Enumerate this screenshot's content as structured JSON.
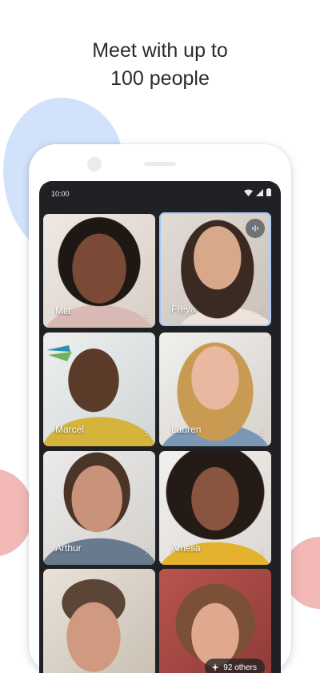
{
  "headline": {
    "line1": "Meet with up to",
    "line2": "100 people"
  },
  "status_bar": {
    "time": "10:00",
    "icons": [
      "wifi-icon",
      "cell-signal-icon",
      "battery-icon"
    ]
  },
  "participants": [
    {
      "name": "Mia",
      "speaking": false
    },
    {
      "name": "Freya",
      "speaking": true
    },
    {
      "name": "Marcel",
      "speaking": false
    },
    {
      "name": "Lauren",
      "speaking": false
    },
    {
      "name": "Arthur",
      "speaking": false
    },
    {
      "name": "Amelia",
      "speaking": false
    },
    {
      "name": "",
      "speaking": false
    },
    {
      "name": "",
      "speaking": false
    }
  ],
  "others_chip": {
    "label": "92 others"
  },
  "colors": {
    "screen_bg": "#202124",
    "active_speaker_ring": "#a8c7fa",
    "blob_blue": "#d2e2fb",
    "blob_pink": "#f2b8b5"
  }
}
